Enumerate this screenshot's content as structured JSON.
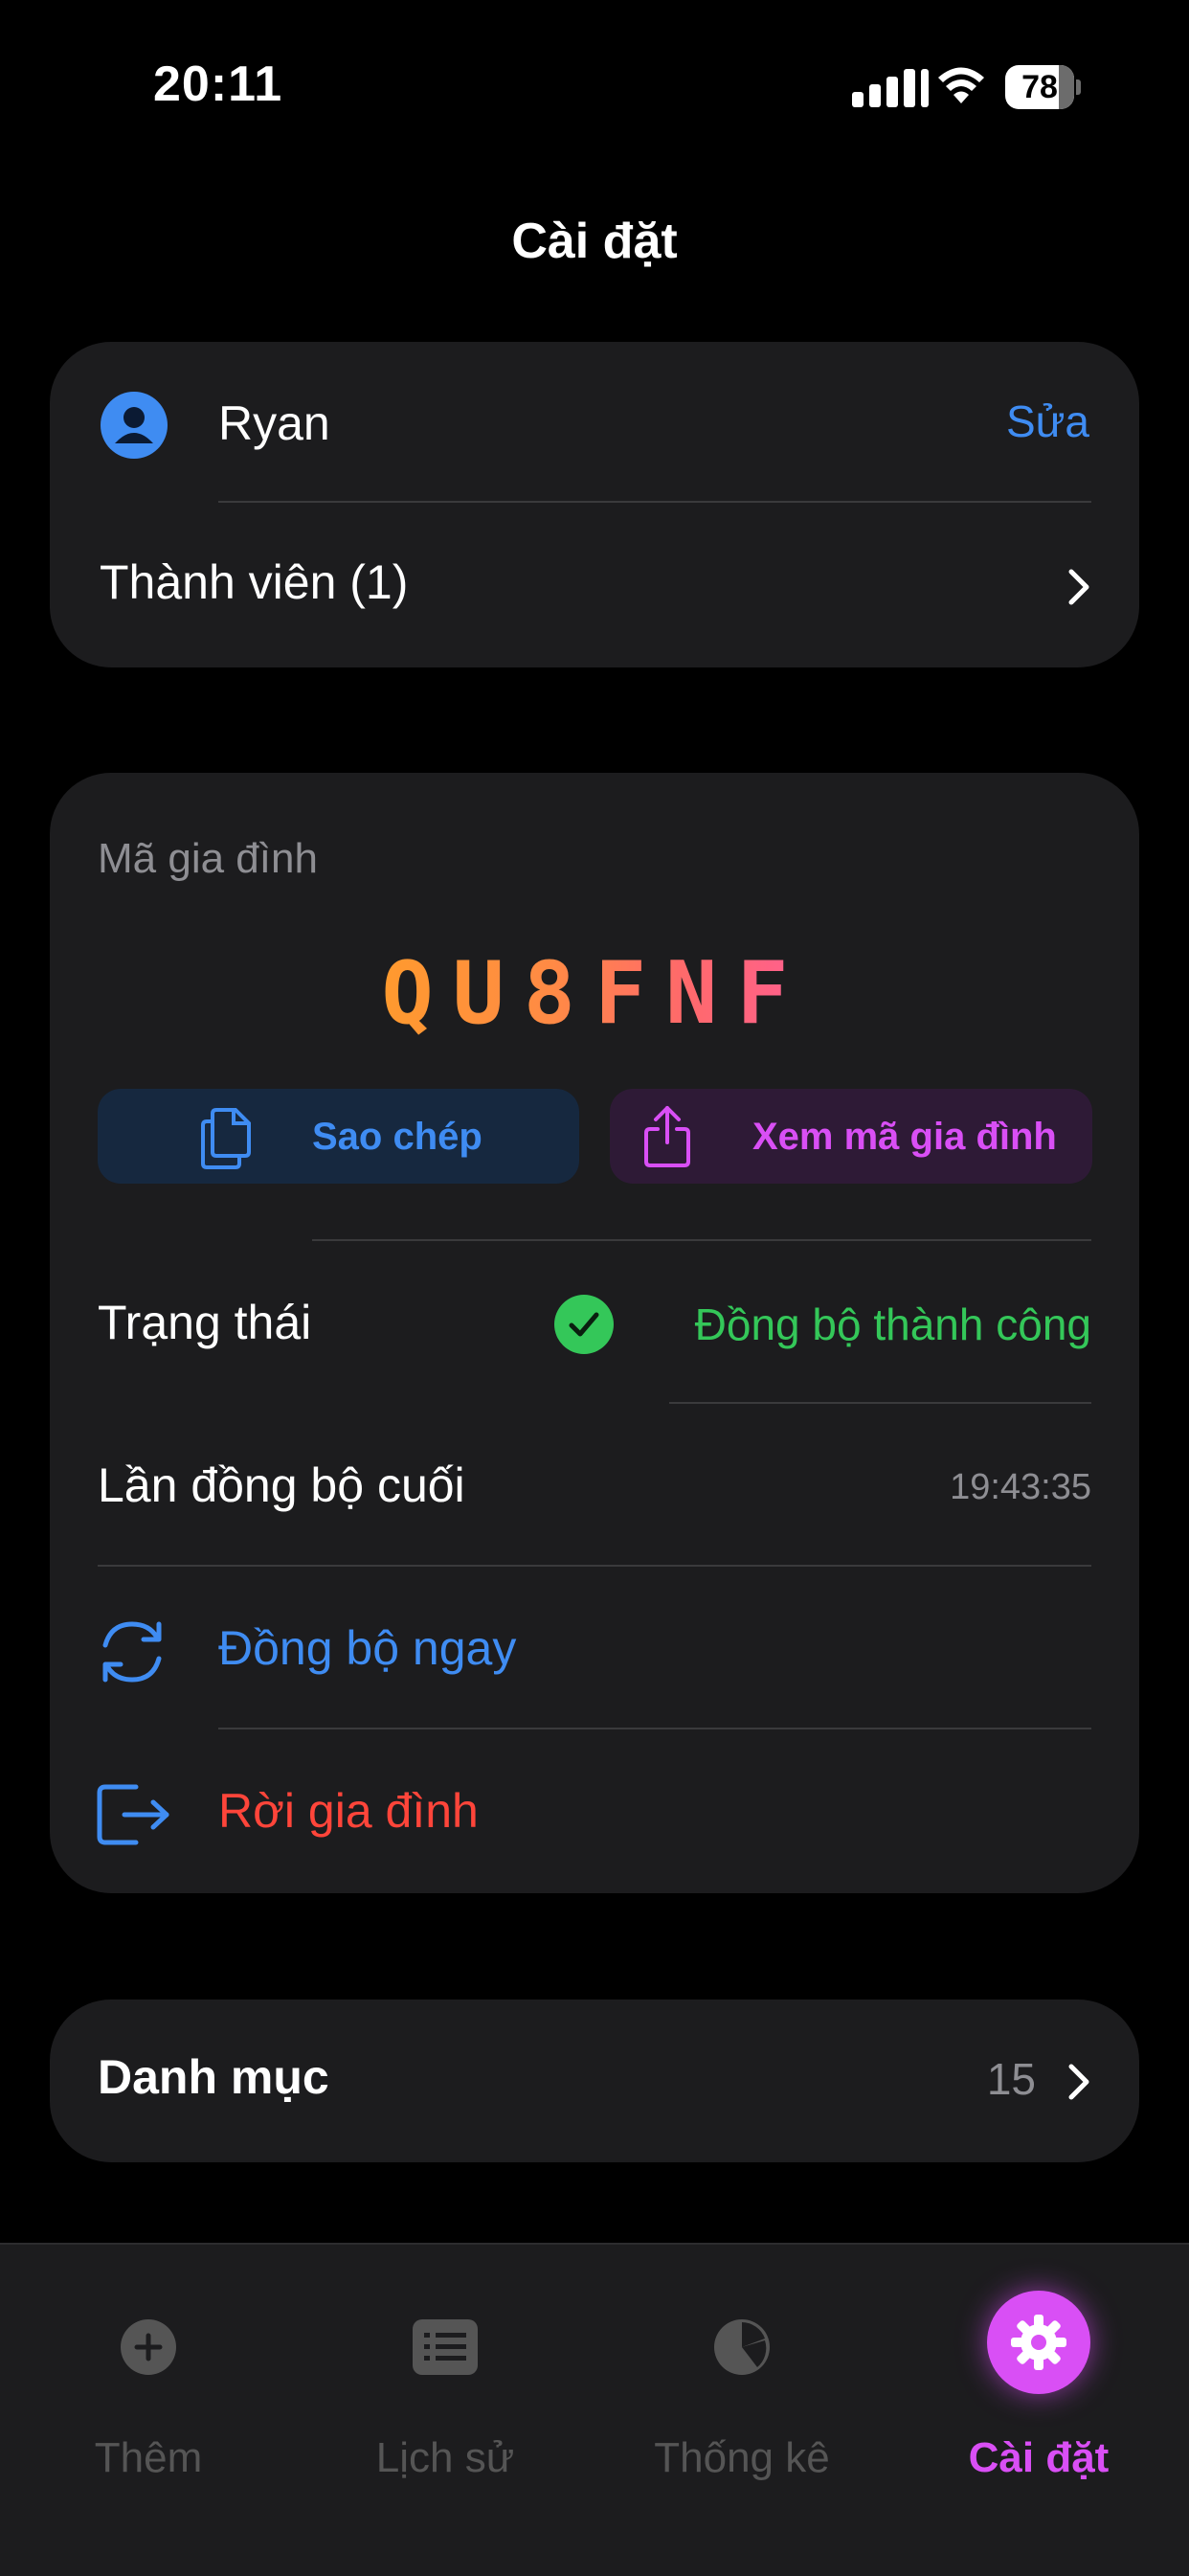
{
  "status_bar": {
    "time": "20:11",
    "battery": 78
  },
  "header": {
    "title": "Cài đặt"
  },
  "profile": {
    "name": "Ryan",
    "edit_label": "Sửa",
    "members_label": "Thành viên (1)"
  },
  "family": {
    "section_label": "Mã gia đình",
    "code": "QU8FNF",
    "copy_label": "Sao chép",
    "view_code_label": "Xem mã gia đình",
    "status_label": "Trạng thái",
    "status_value": "Đồng bộ thành công",
    "last_sync_label": "Lần đồng bộ cuối",
    "last_sync_value": "19:43:35",
    "sync_now_label": "Đồng bộ ngay",
    "leave_label": "Rời gia đình"
  },
  "categories": {
    "label": "Danh mục",
    "count": "15"
  },
  "tabs": [
    {
      "label": "Thêm",
      "icon": "plus-circle-icon",
      "active": false
    },
    {
      "label": "Lịch sử",
      "icon": "list-icon",
      "active": false
    },
    {
      "label": "Thống kê",
      "icon": "pie-chart-icon",
      "active": false
    },
    {
      "label": "Cài đặt",
      "icon": "gear-icon",
      "active": true
    }
  ],
  "colors": {
    "accent_blue": "#3f8cf2",
    "success_green": "#34c759",
    "danger_red": "#ff453a",
    "accent_purple": "#d94ff5",
    "card_bg": "#1c1c1e"
  }
}
